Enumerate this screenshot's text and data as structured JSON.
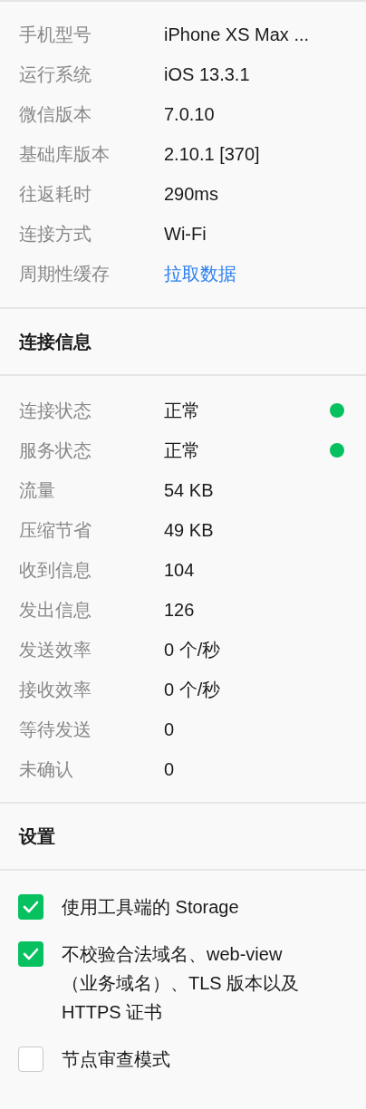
{
  "device_info": [
    {
      "label": "手机型号",
      "value": "iPhone XS Max ...",
      "kind": "text"
    },
    {
      "label": "运行系统",
      "value": "iOS 13.3.1",
      "kind": "text"
    },
    {
      "label": "微信版本",
      "value": "7.0.10",
      "kind": "text"
    },
    {
      "label": "基础库版本",
      "value": "2.10.1 [370]",
      "kind": "text"
    },
    {
      "label": "往返耗时",
      "value": "290ms",
      "kind": "text"
    },
    {
      "label": "连接方式",
      "value": "Wi-Fi",
      "kind": "text"
    },
    {
      "label": "周期性缓存",
      "value": "拉取数据",
      "kind": "link"
    }
  ],
  "connection": {
    "title": "连接信息",
    "rows": [
      {
        "label": "连接状态",
        "value": "正常",
        "color": "#07c160"
      },
      {
        "label": "服务状态",
        "value": "正常",
        "color": "#07c160"
      },
      {
        "label": "流量",
        "value": "54 KB"
      },
      {
        "label": "压缩节省",
        "value": "49 KB"
      },
      {
        "label": "收到信息",
        "value": "104"
      },
      {
        "label": "发出信息",
        "value": "126"
      },
      {
        "label": "发送效率",
        "value": "0 个/秒"
      },
      {
        "label": "接收效率",
        "value": "0 个/秒"
      },
      {
        "label": "等待发送",
        "value": "0"
      },
      {
        "label": "未确认",
        "value": "0"
      }
    ]
  },
  "settings": {
    "title": "设置",
    "options": [
      {
        "label": "使用工具端的 Storage",
        "checked": true
      },
      {
        "label": "不校验合法域名、web-view（业务域名）、TLS 版本以及 HTTPS 证书",
        "checked": true
      },
      {
        "label": "节点审查模式",
        "checked": false
      }
    ]
  }
}
